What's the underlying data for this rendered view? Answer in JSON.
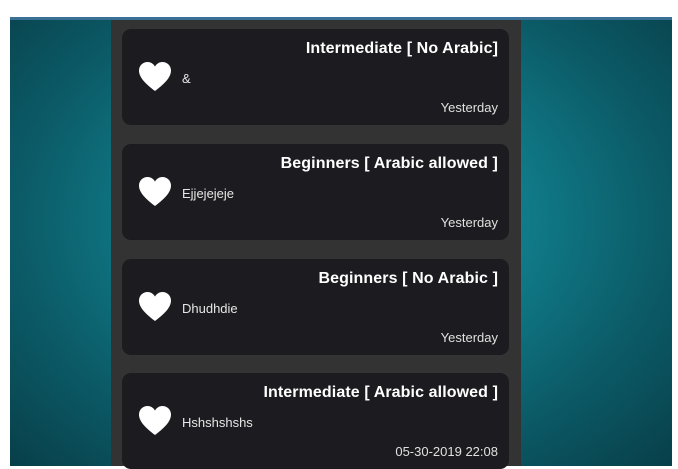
{
  "cards": [
    {
      "title": "Intermediate [ No Arabic]",
      "message": "&",
      "timestamp": "Yesterday",
      "icon": "heart-icon"
    },
    {
      "title": "Beginners [ Arabic allowed ]",
      "message": "Ejjejejeje",
      "timestamp": "Yesterday",
      "icon": "heart-icon"
    },
    {
      "title": "Beginners [ No Arabic ]",
      "message": "Dhudhdie",
      "timestamp": "Yesterday",
      "icon": "heart-icon"
    },
    {
      "title": "Intermediate [ Arabic allowed ]",
      "message": "Hshshshshs",
      "timestamp": "05-30-2019 22:08",
      "icon": "heart-icon"
    }
  ],
  "colors": {
    "background_teal": "#117f8d",
    "column": "#333333",
    "card": "#1c1b1f",
    "text": "#ffffff"
  }
}
